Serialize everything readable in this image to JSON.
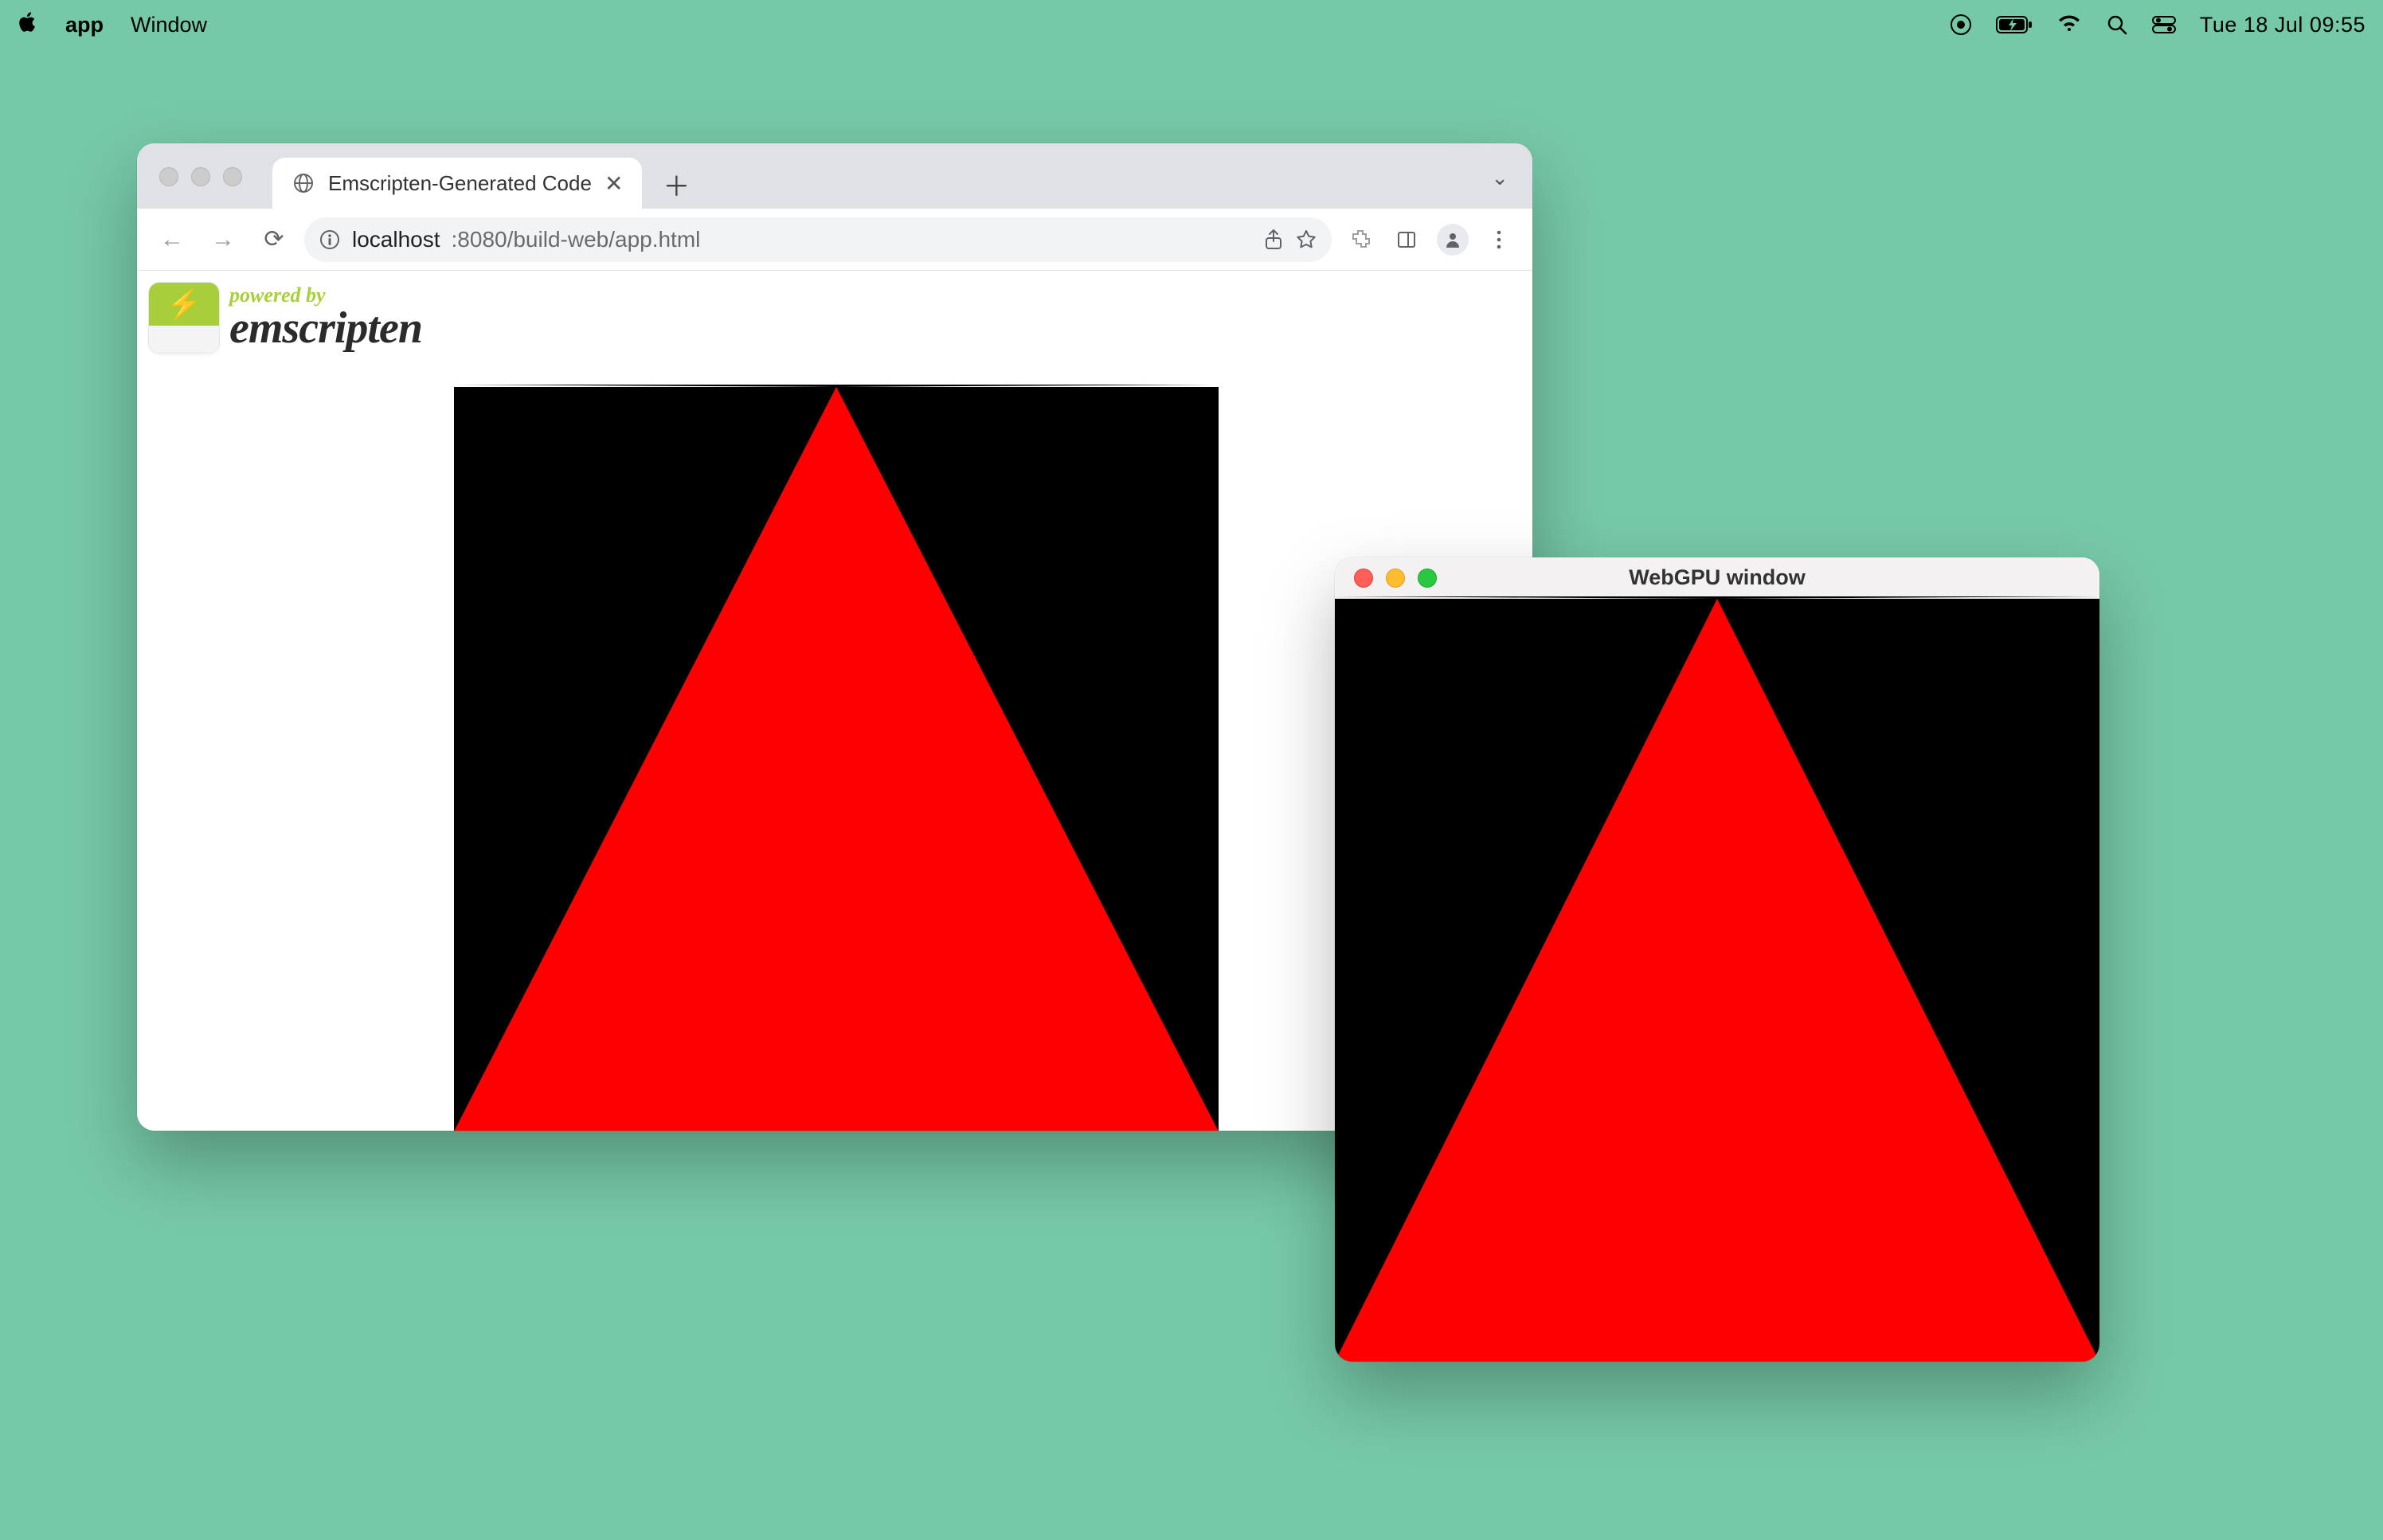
{
  "menubar": {
    "app_name": "app",
    "menu_items": [
      "Window"
    ],
    "datetime": "Tue 18 Jul  09:55"
  },
  "chrome": {
    "tab_title": "Emscripten-Generated Code",
    "url_host": "localhost",
    "url_port_path": ":8080/build-web/app.html",
    "page": {
      "powered_by": "powered by",
      "brand": "emscripten"
    }
  },
  "native": {
    "title": "WebGPU window"
  }
}
